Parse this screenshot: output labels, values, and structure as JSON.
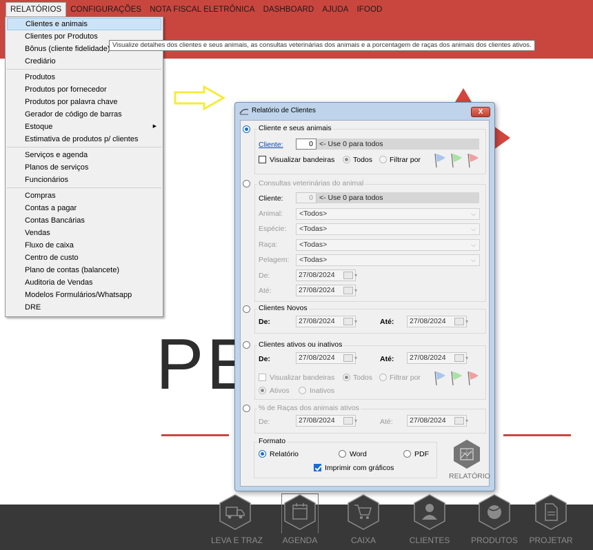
{
  "menubar": {
    "items": [
      "RELATÓRIOS",
      "CONFIGURAÇÕES",
      "NOTA FISCAL ELETRÔNICA",
      "DASHBOARD",
      "AJUDA",
      "IFOOD"
    ]
  },
  "menu": {
    "group1": [
      "Clientes e animais",
      "Clientes por Produtos",
      "Bônus (cliente fidelidade)",
      "Crediário"
    ],
    "group2": [
      "Produtos",
      "Produtos por fornecedor",
      "Produtos por palavra chave",
      "Gerador de código de barras",
      "Estoque",
      "Estimativa de produtos p/ clientes"
    ],
    "group3": [
      "Serviços e agenda",
      "Planos de serviços",
      "Funcionários"
    ],
    "group4": [
      "Compras",
      "Contas a pagar",
      "Contas Bancárias",
      "Vendas",
      "Fluxo de caixa",
      "Centro de custo",
      "Plano de contas (balancete)",
      "Auditoria de Vendas",
      "Modelos Formulários/Whatsapp",
      "DRE"
    ]
  },
  "tooltip": "Visualize detalhes dos clientes e seus animais, as consultas veterinárias dos animais e a porcentagem de raças dos animais dos clientes ativos.",
  "background": {
    "logo_text": "PE        OP"
  },
  "dialog": {
    "title": "Relatório de Clientes",
    "close_label": "X",
    "s1": {
      "caption": "Cliente e seus animais",
      "cliente_label": "Cliente:",
      "cliente_value": "0",
      "cliente_hint": "<- Use 0 para todos",
      "visualizar_bandeiras": "Visualizar bandeiras",
      "todos": "Todos",
      "filtrar_por": "Filtrar por"
    },
    "s2": {
      "caption": "Consultas veterinárias do animal",
      "cliente_label": "Cliente:",
      "cliente_value": "0",
      "cliente_hint": "<- Use 0 para todos",
      "animal_label": "Animal:",
      "animal_value": "<Todos>",
      "especie_label": "Espécie:",
      "especie_value": "<Todas>",
      "raca_label": "Raça:",
      "raca_value": "<Todas>",
      "pelagem_label": "Pelagem:",
      "pelagem_value": "<Todas>",
      "de_label": "De:",
      "de_value": "27/08/2024",
      "ate_label": "Até:",
      "ate_value": "27/08/2024"
    },
    "s3": {
      "caption": "Clientes Novos",
      "de_label": "De:",
      "de_value": "27/08/2024",
      "ate_label": "Até:",
      "ate_value": "27/08/2024"
    },
    "s4": {
      "caption": "Clientes ativos ou inativos",
      "de_label": "De:",
      "de_value": "27/08/2024",
      "ate_label": "Até:",
      "ate_value": "27/08/2024",
      "visualizar_bandeiras": "Visualizar bandeiras",
      "todos": "Todos",
      "filtrar_por": "Filtrar por",
      "ativos": "Ativos",
      "inativos": "Inativos"
    },
    "s5": {
      "caption": "% de Raças dos animais ativos",
      "de_label": "De:",
      "de_value": "27/08/2024",
      "ate_label": "Até:",
      "ate_value": "27/08/2024"
    },
    "formato": {
      "caption": "Formato",
      "relatorio": "Relatório",
      "word": "Word",
      "pdf": "PDF",
      "imprimir": "Imprimir com gráficos"
    },
    "relatorio_button": "RELATÓRIO"
  },
  "dock": {
    "items": [
      "LEVA E TRAZ",
      "AGENDA",
      "CAIXA",
      "CLIENTES",
      "PRODUTOS",
      "PROJETAR"
    ]
  },
  "colors": {
    "brand_red": "#c9463f",
    "dock_bg": "#383838",
    "menu_highlight": "#cce4f7",
    "dialog_frame": "#bfd4ea",
    "accent_blue": "#1b6ccf",
    "arrow_yellow": "#f5ec3a"
  },
  "icons": {
    "flags": [
      "flag-blue-icon",
      "flag-green-icon",
      "flag-red-icon"
    ],
    "dock": [
      "truck-icon",
      "calendar-icon",
      "cart-icon",
      "person-icon",
      "ball-icon",
      "document-icon"
    ]
  }
}
